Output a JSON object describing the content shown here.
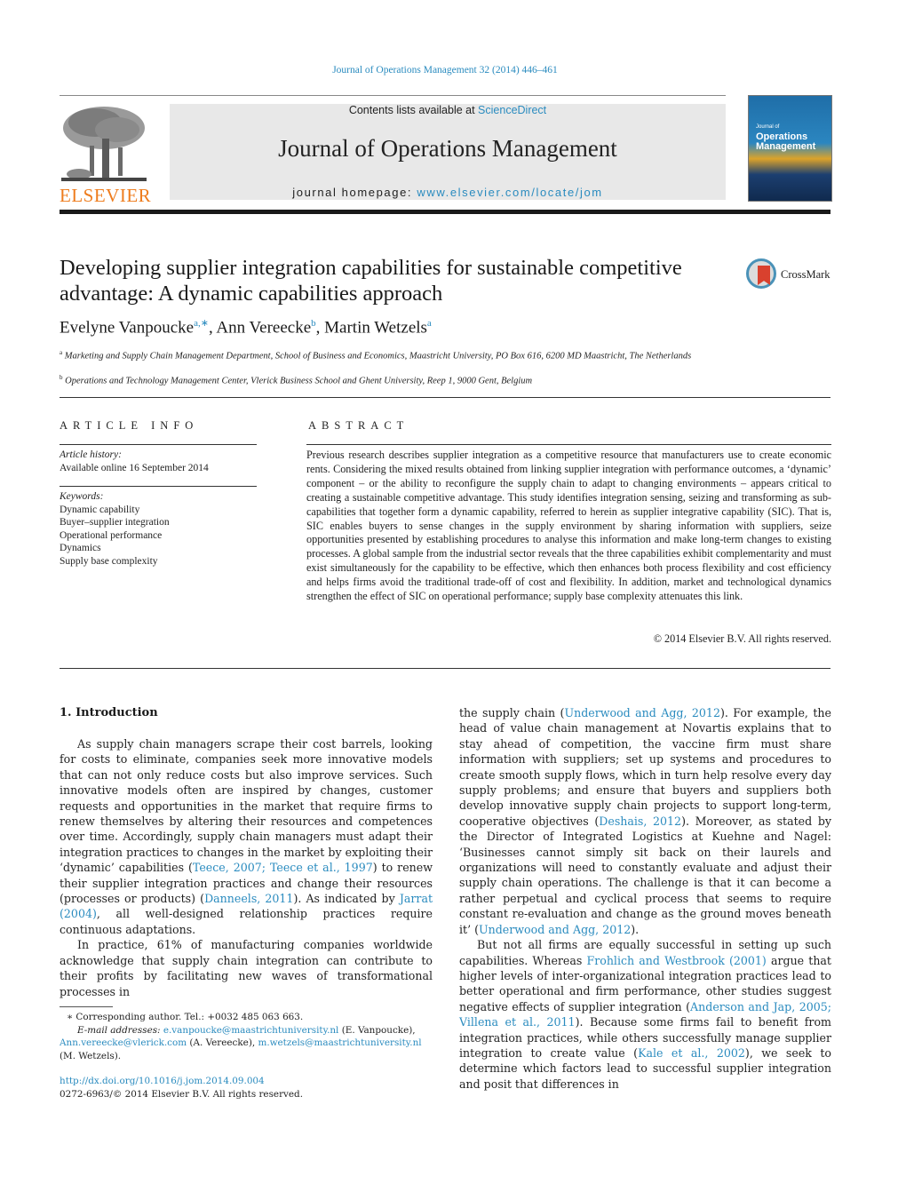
{
  "header": {
    "journal_reference": "Journal of Operations Management 32 (2014) 446–461",
    "publisher_logo_text": "ELSEVIER",
    "contents_prefix": "Contents lists available at ",
    "contents_link": "ScienceDirect",
    "journal_title": "Journal of Operations Management",
    "homepage_prefix": "journal homepage: ",
    "homepage_link": "www.elsevier.com/locate/jom",
    "cover": {
      "line1": "Journal of",
      "line2": "Operations",
      "line3": "Management"
    }
  },
  "article": {
    "title": "Developing supplier integration capabilities for sustainable competitive advantage: A dynamic capabilities approach",
    "crossmark_label": "CrossMark",
    "authors": [
      {
        "name": "Evelyne Vanpoucke",
        "sup": "a,∗"
      },
      {
        "name": "Ann Vereecke",
        "sup": "b"
      },
      {
        "name": "Martin Wetzels",
        "sup": "a"
      }
    ],
    "affiliations": [
      {
        "key": "a",
        "text": "Marketing and Supply Chain Management Department, School of Business and Economics, Maastricht University, PO Box 616, 6200 MD Maastricht, The Netherlands"
      },
      {
        "key": "b",
        "text": "Operations and Technology Management Center, Vlerick Business School and Ghent University, Reep 1, 9000 Gent, Belgium"
      }
    ]
  },
  "article_info": {
    "heading": "ARTICLE INFO",
    "history_label": "Article history:",
    "history_value": "Available online 16 September 2014",
    "keywords_label": "Keywords:",
    "keywords": [
      "Dynamic capability",
      "Buyer–supplier integration",
      "Operational performance",
      "Dynamics",
      "Supply base complexity"
    ]
  },
  "abstract": {
    "heading": "ABSTRACT",
    "text": "Previous research describes supplier integration as a competitive resource that manufacturers use to create economic rents. Considering the mixed results obtained from linking supplier integration with performance outcomes, a ‘dynamic’ component – or the ability to reconfigure the supply chain to adapt to changing environments – appears critical to creating a sustainable competitive advantage. This study identifies integration sensing, seizing and transforming as sub-capabilities that together form a dynamic capability, referred to herein as supplier integrative capability (SIC). That is, SIC enables buyers to sense changes in the supply environment by sharing information with suppliers, seize opportunities presented by establishing procedures to analyse this information and make long-term changes to existing processes. A global sample from the industrial sector reveals that the three capabilities exhibit complementarity and must exist simultaneously for the capability to be effective, which then enhances both process flexibility and cost efficiency and helps firms avoid the traditional trade-off of cost and flexibility. In addition, market and technological dynamics strengthen the effect of SIC on operational performance; supply base complexity attenuates this link.",
    "copyright": "© 2014 Elsevier B.V. All rights reserved."
  },
  "body": {
    "section_heading": "1.  Introduction",
    "left": {
      "p1_a": "As supply chain managers scrape their cost barrels, looking for costs to eliminate, companies seek more innovative models that can not only reduce costs but also improve services. Such innovative models often are inspired by changes, customer requests and opportunities in the market that require firms to renew themselves by altering their resources and competences over time. Accordingly, supply chain managers must adapt their integration practices to changes in the market by exploiting their ‘dynamic’ capabilities (",
      "p1_ref1": "Teece, 2007; Teece et al., 1997",
      "p1_b": ") to renew their supplier integration practices and change their resources (processes or products) (",
      "p1_ref2": "Danneels, 2011",
      "p1_c": "). As indicated by ",
      "p1_ref3": "Jarrat (2004)",
      "p1_d": ", all well-designed relationship practices require continuous adaptations.",
      "p2": "In practice, 61% of manufacturing companies worldwide acknowledge that supply chain integration can contribute to their profits by facilitating new waves of transformational processes in"
    },
    "right": {
      "p1_a": "the supply chain (",
      "p1_ref1": "Underwood and Agg, 2012",
      "p1_b": "). For example, the head of value chain management at Novartis explains that to stay ahead of competition, the vaccine firm must share information with suppliers; set up systems and procedures to create smooth supply flows, which in turn help resolve every day supply problems; and ensure that buyers and suppliers both develop innovative supply chain projects to support long-term, cooperative objectives (",
      "p1_ref2": "Deshais, 2012",
      "p1_c": "). Moreover, as stated by the Director of Integrated Logistics at Kuehne and Nagel: ‘Businesses cannot simply sit back on their laurels and organizations will need to constantly evaluate and adjust their supply chain operations. The challenge is that it can become a rather perpetual and cyclical process that seems to require constant re-evaluation and change as the ground moves beneath it’ (",
      "p1_ref3": "Underwood and Agg, 2012",
      "p1_d": ").",
      "p2_a": "But not all firms are equally successful in setting up such capabilities. Whereas ",
      "p2_ref1": "Frohlich and Westbrook (2001)",
      "p2_b": " argue that higher levels of inter-organizational integration practices lead to better operational and firm performance, other studies suggest negative effects of supplier integration (",
      "p2_ref2": "Anderson and Jap, 2005; Villena et al., 2011",
      "p2_c": "). Because some firms fail to benefit from integration practices, while others successfully manage supplier integration to create value (",
      "p2_ref3": "Kale et al., 2002",
      "p2_d": "), we seek to determine which factors lead to successful supplier integration and posit that differences in"
    }
  },
  "footnotes": {
    "corresponding": "∗  Corresponding author. Tel.: +0032 485 063 663.",
    "email_label": "E-mail addresses:",
    "email1": "e.vanpoucke@maastrichtuniversity.nl",
    "email1_name": " (E. Vanpoucke),",
    "email2": "Ann.vereecke@vlerick.com",
    "email2_name": " (A. Vereecke), ",
    "email3": "m.wetzels@maastrichtuniversity.nl",
    "email3_name": "(M. Wetzels).",
    "doi": "http://dx.doi.org/10.1016/j.jom.2014.09.004",
    "issn_copyright": "0272-6963/© 2014 Elsevier B.V. All rights reserved."
  }
}
